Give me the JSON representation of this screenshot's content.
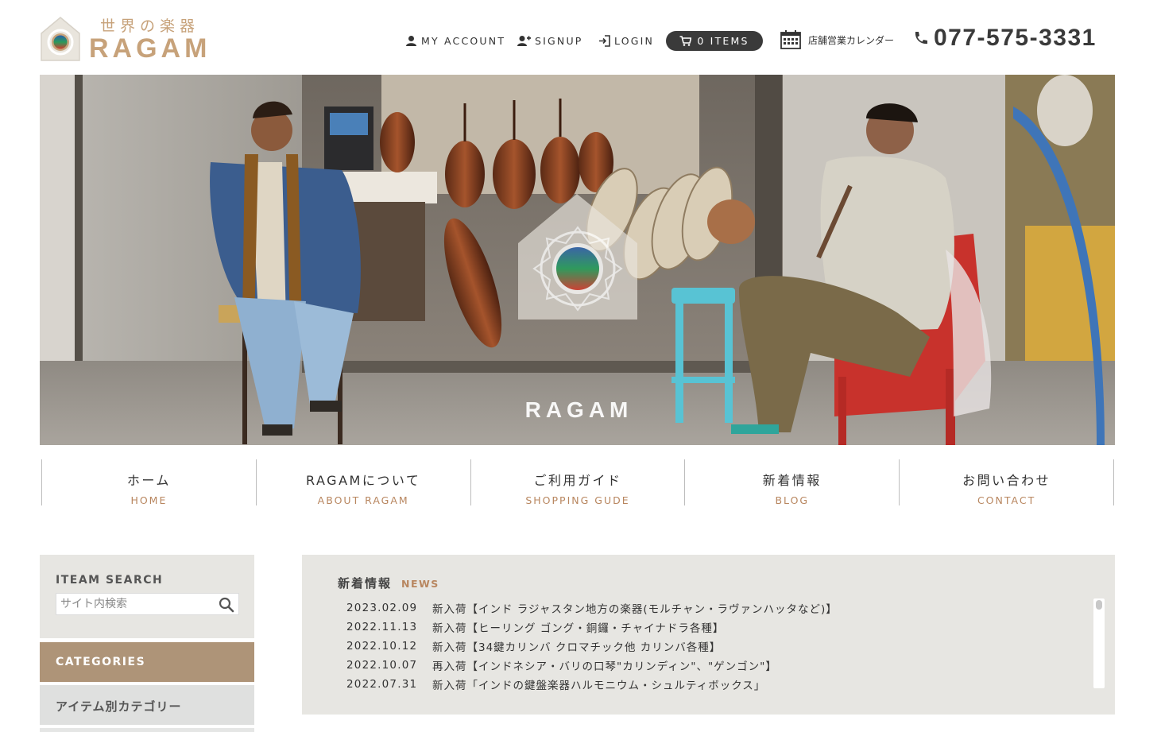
{
  "header": {
    "logo_jp": "世界の楽器",
    "logo_en": "RAGAM",
    "nav": {
      "my_account": "MY ACCOUNT",
      "signup": "SIGNUP",
      "login": "LOGIN"
    },
    "cart_label": "0 ITEMS",
    "calendar_label": "店舗営業カレンダー",
    "phone": "077-575-3331",
    "icons": [
      "user-icon",
      "user-plus-icon",
      "login-icon",
      "cart-icon",
      "calendar-icon",
      "phone-icon"
    ]
  },
  "hero": {
    "brand": "RAGAM"
  },
  "global_nav": [
    {
      "jp": "ホーム",
      "en": "HOME"
    },
    {
      "jp": "RAGAMについて",
      "en": "ABOUT RAGAM"
    },
    {
      "jp": "ご利用ガイド",
      "en": "SHOPPING GUDE"
    },
    {
      "jp": "新着情報",
      "en": "BLOG"
    },
    {
      "jp": "お問い合わせ",
      "en": "CONTACT"
    }
  ],
  "sidebar": {
    "search_title": "ITEAM SEARCH",
    "search_placeholder": "サイト内検索",
    "categories_title": "CATEGORIES",
    "category_item": "アイテム別カテゴリー"
  },
  "news": {
    "title_jp": "新着情報",
    "title_en": "NEWS",
    "items": [
      {
        "date": "2023.02.09",
        "text": "新入荷【インド ラジャスタン地方の楽器(モルチャン・ラヴァンハッタなど)】"
      },
      {
        "date": "2022.11.13",
        "text": "新入荷【ヒーリング ゴング・銅鑼・チャイナドラ各種】"
      },
      {
        "date": "2022.10.12",
        "text": "新入荷【34鍵カリンバ クロマチック他 カリンバ各種】"
      },
      {
        "date": "2022.10.07",
        "text": "再入荷【インドネシア・バリの口琴\"カリンディン\"、\"ゲンゴン\"】"
      },
      {
        "date": "2022.07.31",
        "text": "新入荷「インドの鍵盤楽器ハルモニウム・シュルティボックス」"
      }
    ]
  },
  "colors": {
    "brand_gold": "#c7a27a",
    "accent_brown": "#b8865f",
    "category_bar": "#ae9478",
    "panel_bg": "#e7e6e2"
  }
}
